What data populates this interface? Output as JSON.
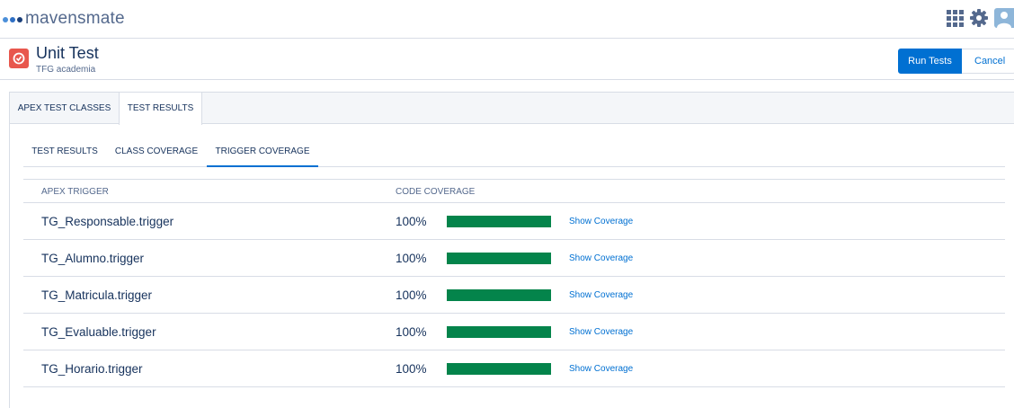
{
  "app": {
    "logo_text": "mavensmate",
    "logo_dot_colors": [
      "#4b8fd9",
      "#2f6fc4",
      "#1a3f7a"
    ],
    "icons": [
      "apps-grid-icon",
      "gear-icon",
      "user-avatar-icon"
    ]
  },
  "header": {
    "title": "Unit Test",
    "subtitle": "TFG academia",
    "icon": "stopwatch-icon",
    "icon_color": "#e8574d",
    "run_label": "Run Tests",
    "cancel_label": "Cancel"
  },
  "tabs": {
    "outer": [
      {
        "label": "APEX TEST CLASSES",
        "active": false
      },
      {
        "label": "TEST RESULTS",
        "active": true
      }
    ],
    "inner": [
      {
        "label": "TEST RESULTS",
        "active": false
      },
      {
        "label": "CLASS COVERAGE",
        "active": false
      },
      {
        "label": "TRIGGER COVERAGE",
        "active": true
      }
    ]
  },
  "table": {
    "columns": [
      "APEX TRIGGER",
      "CODE COVERAGE"
    ],
    "link_label": "Show Coverage",
    "bar_color": "#04844b",
    "rows": [
      {
        "name": "TG_Responsable.trigger",
        "coverage": "100%",
        "fraction": 1.0
      },
      {
        "name": "TG_Alumno.trigger",
        "coverage": "100%",
        "fraction": 1.0
      },
      {
        "name": "TG_Matricula.trigger",
        "coverage": "100%",
        "fraction": 1.0
      },
      {
        "name": "TG_Evaluable.trigger",
        "coverage": "100%",
        "fraction": 1.0
      },
      {
        "name": "TG_Horario.trigger",
        "coverage": "100%",
        "fraction": 1.0
      }
    ]
  }
}
